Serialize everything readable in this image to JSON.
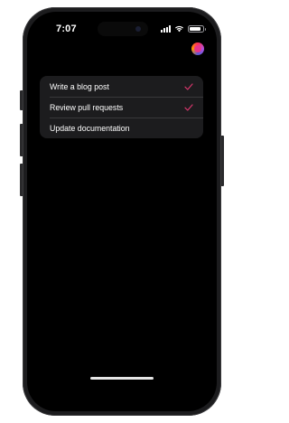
{
  "status_bar": {
    "time": "7:07",
    "battery_level": 0.85,
    "signal_bars": 4
  },
  "avatar": {
    "icon": "profile-avatar-icon",
    "color": "#e8348a"
  },
  "tasks": [
    {
      "title": "Write a blog post",
      "completed": true
    },
    {
      "title": "Review pull requests",
      "completed": true
    },
    {
      "title": "Update documentation",
      "completed": false
    }
  ],
  "colors": {
    "background": "#000000",
    "card": "#1c1c1e",
    "checkmark": "#d4356b",
    "text": "#ffffff"
  }
}
